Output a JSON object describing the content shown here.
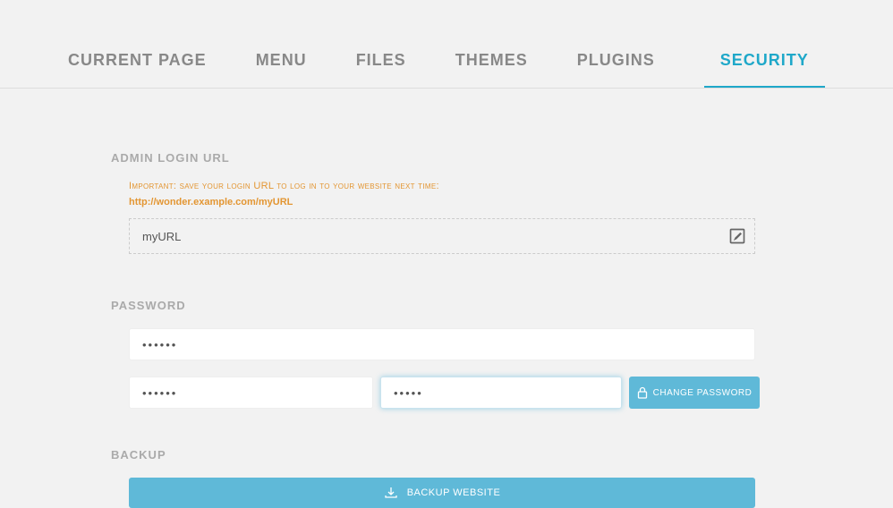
{
  "tabs": {
    "current_page": "current page",
    "menu": "menu",
    "files": "files",
    "themes": "themes",
    "plugins": "plugins",
    "security": "security"
  },
  "admin_login": {
    "title": "admin login url",
    "important_text": "Important: save your login URL to log in to your website next time:",
    "url_link": "http://wonder.example.com/myURL",
    "url_value": "myURL"
  },
  "password": {
    "title": "password",
    "field1": "••••••",
    "field2": "••••••",
    "field3": "•••••",
    "button_label": "change password"
  },
  "backup": {
    "title": "backup",
    "button_label": "backup website"
  }
}
